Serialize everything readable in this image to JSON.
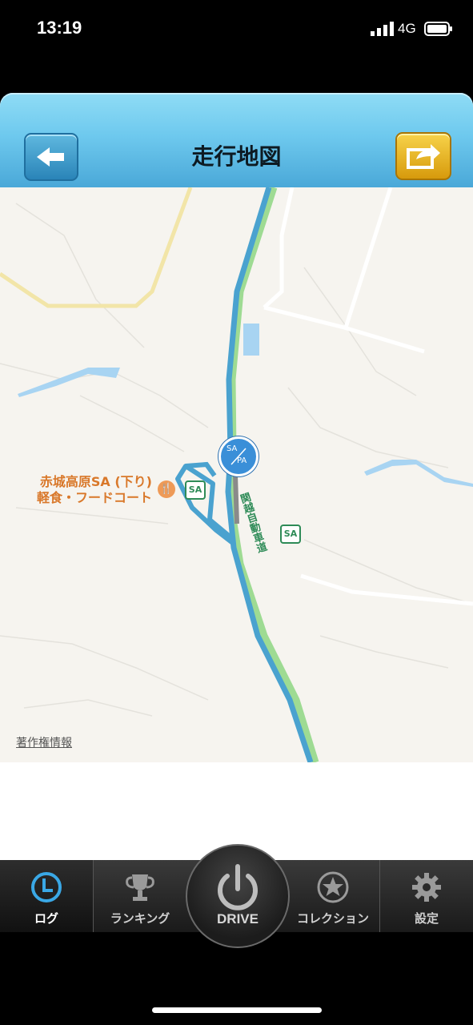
{
  "status_bar": {
    "time": "13:19",
    "network": "4G"
  },
  "nav": {
    "title": "走行地図",
    "back_icon": "back-arrow-icon",
    "share_icon": "share-icon"
  },
  "map": {
    "poi_name_line1": "赤城高原SA (下り)",
    "poi_name_line2": "軽食・フードコート",
    "sa_badge": "SA",
    "sapa_top": "SA",
    "sapa_bottom": "PA",
    "road_label": "関越自動車道",
    "copyright": "著作権情報"
  },
  "tabbar": {
    "tabs": [
      {
        "label": "ログ",
        "icon": "clock-icon",
        "active": true
      },
      {
        "label": "ランキング",
        "icon": "trophy-icon",
        "active": false
      },
      {
        "label": "DRIVE",
        "icon": "power-icon",
        "active": false
      },
      {
        "label": "コレクション",
        "icon": "star-icon",
        "active": false
      },
      {
        "label": "設定",
        "icon": "gear-icon",
        "active": false
      }
    ]
  },
  "colors": {
    "nav_top": "#8fdcf5",
    "nav_bottom": "#4aa8d8",
    "route": "#4aa2cf",
    "expressway": "#8fd68a",
    "tab_active": "#3aa8e6"
  }
}
